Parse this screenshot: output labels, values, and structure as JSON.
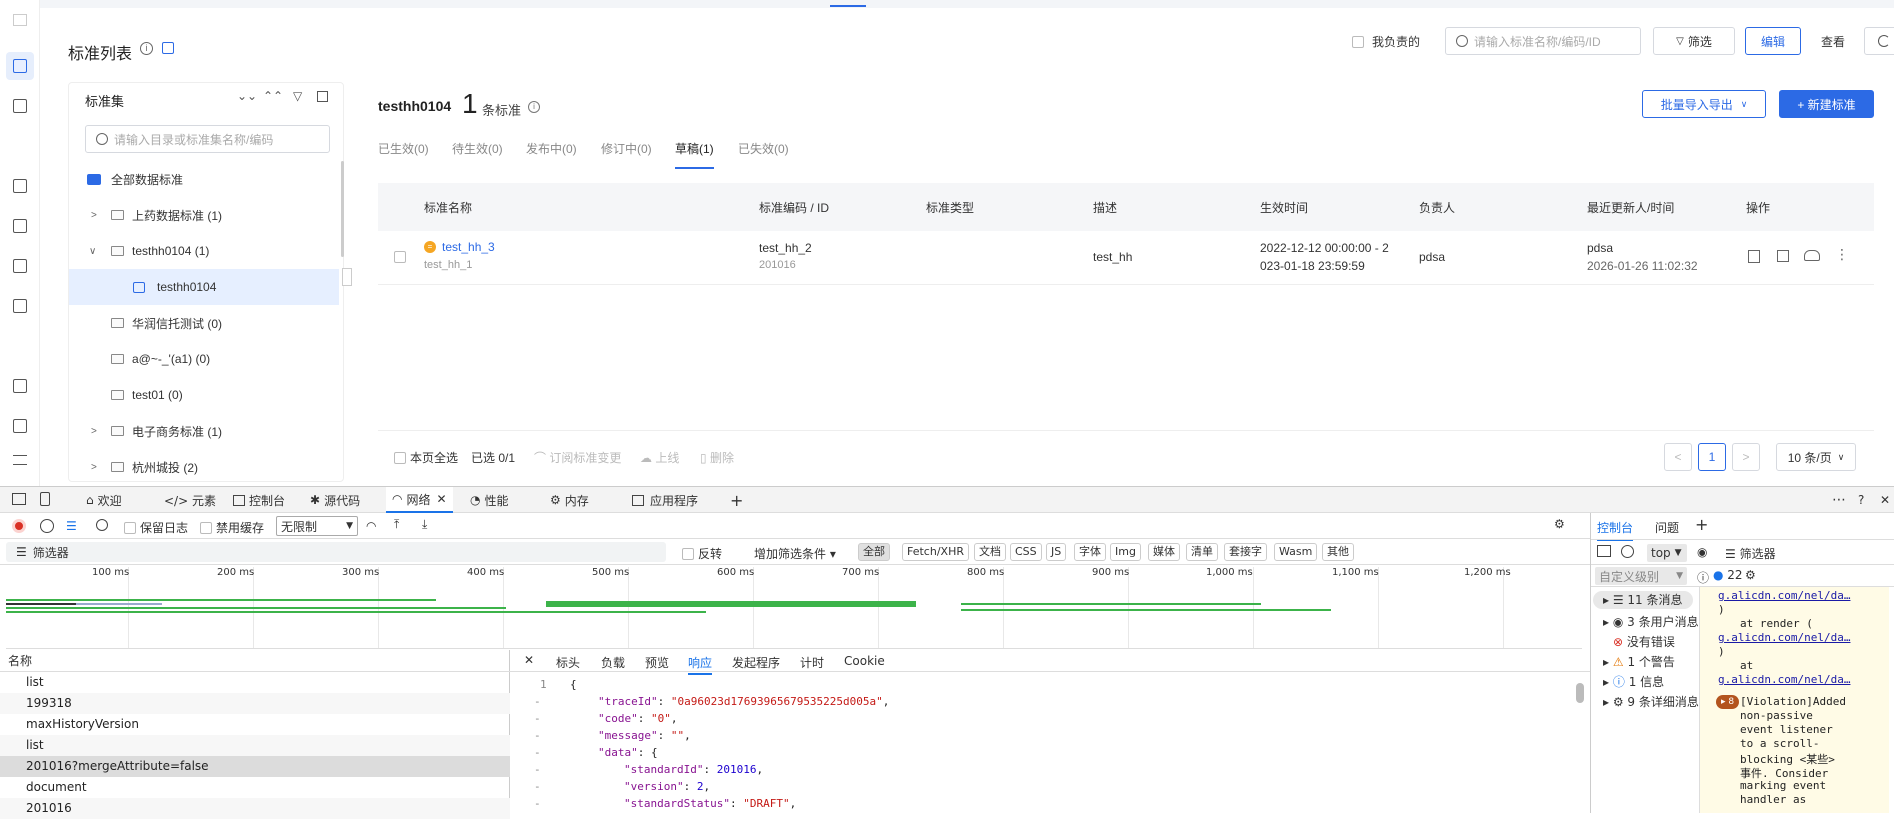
{
  "header": {
    "title": "标准列表",
    "mine_label": "我负责的",
    "search_placeholder": "请输入标准名称/编码/ID",
    "filter_label": "筛选",
    "edit_label": "编辑",
    "view_label": "查看"
  },
  "tree": {
    "title": "标准集",
    "search_placeholder": "请输入目录或标准集名称/编码",
    "items": [
      {
        "label": "全部数据标准"
      },
      {
        "label": "上药数据标准 (1)"
      },
      {
        "label": "testhh0104 (1)"
      },
      {
        "label": "testhh0104"
      },
      {
        "label": "华润信托测试 (0)"
      },
      {
        "label": "a@~-_'(a1) (0)"
      },
      {
        "label": "test01 (0)"
      },
      {
        "label": "电子商务标准 (1)"
      },
      {
        "label": "杭州城投 (2)"
      }
    ]
  },
  "main": {
    "set_name": "testhh0104",
    "count": "1",
    "count_unit": "条标准",
    "batch_label": "批量导入导出",
    "new_label": "+ 新建标准",
    "tabs": [
      "已生效(0)",
      "待生效(0)",
      "发布中(0)",
      "修订中(0)",
      "草稿(1)",
      "已失效(0)"
    ],
    "columns": [
      "标准名称",
      "标准编码 / ID",
      "标准类型",
      "描述",
      "生效时间",
      "负责人",
      "最近更新人/时间",
      "操作"
    ],
    "rows": [
      {
        "name": "test_hh_3",
        "name_sub": "test_hh_1",
        "code": "test_hh_2",
        "id": "201016",
        "type": "",
        "desc": "test_hh",
        "time1": "2022-12-12 00:00:00 - 2",
        "time2": "023-01-18 23:59:59",
        "owner": "pdsa",
        "updater": "pdsa",
        "updated": "2026-01-26 11:02:32"
      }
    ],
    "footer": {
      "select_all": "本页全选",
      "selected": "已选 0/1",
      "subscribe": "订阅标准变更",
      "online": "上线",
      "delete": "删除",
      "page": "1",
      "page_size": "10 条/页"
    }
  },
  "devtools": {
    "tabs": [
      "欢迎",
      "</> 元素",
      "控制台",
      "源代码",
      "网络",
      "性能",
      "内存",
      "应用程序"
    ],
    "toolbar": {
      "preserve": "保留日志",
      "disable_cache": "禁用缓存",
      "throttle": "无限制"
    },
    "filter": {
      "placeholder": "筛选器",
      "invert": "反转",
      "more": "增加筛选条件",
      "types": [
        "全部",
        "Fetch/XHR",
        "文档",
        "CSS",
        "JS",
        "字体",
        "Img",
        "媒体",
        "清单",
        "套接字",
        "Wasm",
        "其他"
      ]
    },
    "ticks": [
      "100 ms",
      "200 ms",
      "300 ms",
      "400 ms",
      "500 ms",
      "600 ms",
      "700 ms",
      "800 ms",
      "900 ms",
      "1,000 ms",
      "1,100 ms",
      "1,200 ms"
    ],
    "name_header": "名称",
    "requests": [
      "list",
      "199318",
      "maxHistoryVersion",
      "list",
      "201016?mergeAttribute=false",
      "document",
      "201016"
    ],
    "detail_tabs": [
      "标头",
      "负载",
      "预览",
      "响应",
      "发起程序",
      "计时",
      "Cookie"
    ],
    "response": {
      "traceId": "0a96023d17693965679535225d005a",
      "code": "0",
      "message": "",
      "standardId": "201016",
      "version": "2",
      "standardStatus": "DRAFT"
    },
    "console": {
      "tabs": [
        "控制台",
        "问题"
      ],
      "context": "top",
      "filter": "筛选器",
      "level": "自定义级别",
      "count": "22",
      "groups": [
        "11 条消息",
        "3 条用户消息",
        "没有错误",
        "1 个警告",
        "1 信息",
        "9 条详细消息"
      ],
      "log": [
        "g.alicdn.com/nel/da…",
        ")",
        "at render (",
        "g.alicdn.com/nel/da…",
        ")",
        "at",
        "g.alicdn.com/nel/da…"
      ],
      "violation_count": "8",
      "violation": [
        "[Violation]Added",
        "non-passive",
        "event listener",
        "to a scroll-",
        "blocking <某些>",
        "事件. Consider",
        "marking event",
        "handler as"
      ]
    }
  }
}
